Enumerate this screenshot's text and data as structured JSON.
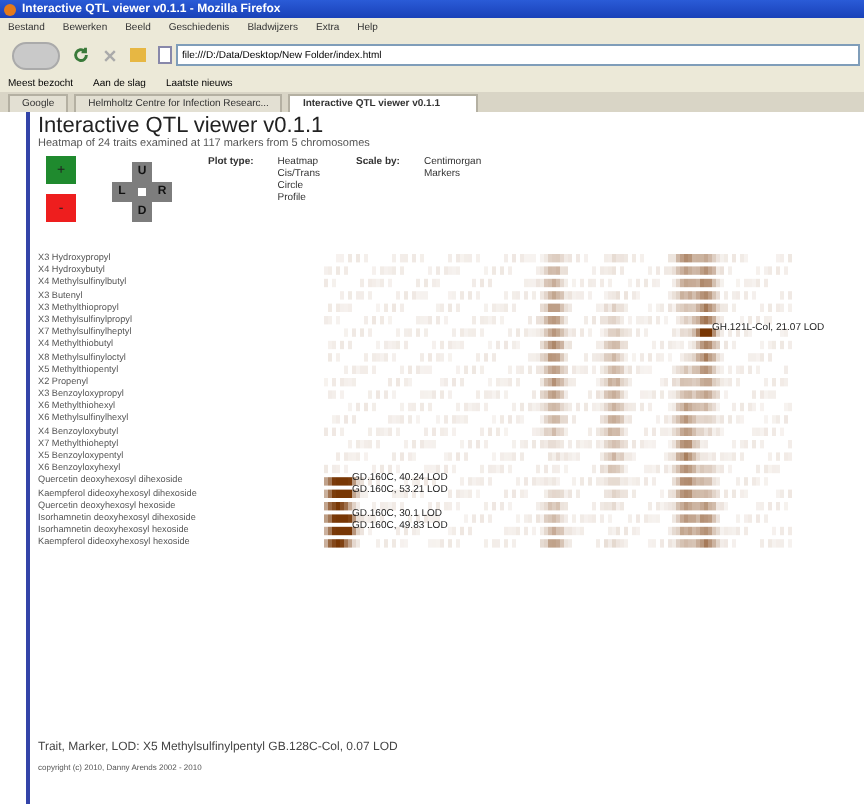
{
  "window": {
    "title": "Interactive QTL viewer v0.1.1 - Mozilla Firefox"
  },
  "menu": [
    "Bestand",
    "Bewerken",
    "Beeld",
    "Geschiedenis",
    "Bladwijzers",
    "Extra",
    "Help"
  ],
  "address": {
    "value": "file:///D:/Data/Desktop/New Folder/index.html"
  },
  "bookmarks": [
    "Meest bezocht",
    "Aan de slag",
    "Laatste nieuws"
  ],
  "tabs": [
    {
      "label": "Google",
      "selected": false
    },
    {
      "label": "Helmholtz Centre for Infection Researc...",
      "selected": false
    },
    {
      "label": "Interactive QTL viewer v0.1.1",
      "selected": true
    }
  ],
  "page": {
    "title": "Interactive QTL viewer v0.1.1",
    "subtitle": "Heatmap of 24 traits examined at 117 markers from 5 chromosomes",
    "zoom_in": "+",
    "zoom_out": "-",
    "pad": [
      "U",
      "L",
      "R",
      "D"
    ],
    "plot_type": {
      "label": "Plot type:",
      "options": [
        "Heatmap",
        "Cis/Trans",
        "Circle",
        "Profile"
      ]
    },
    "scale_by": {
      "label": "Scale by:",
      "options": [
        "Centimorgan",
        "Markers"
      ]
    },
    "traits": [
      "X3 Hydroxypropyl",
      "X4 Hydroxybutyl",
      "X4 Methylsulfinylbutyl",
      "X3 Butenyl",
      "X3 Methylthiopropyl",
      "X3 Methylsulfinylpropyl",
      "X7 Methylsulfinylheptyl",
      "X4 Methylthiobutyl",
      "X8 Methylsulfinyloctyl",
      "X5 Methylthiopentyl",
      "X2 Propenyl",
      "X3 Benzoyloxypropyl",
      "X6 Methylthiohexyl",
      "X6 Methylsulfinylhexyl",
      "X4 Benzoyloxybutyl",
      "X7 Methylthioheptyl",
      "X5 Benzoyloxypentyl",
      "X6 Benzoyloxyhexyl",
      "Quercetin deoxyhexosyl dihexoside",
      "Kaempferol dideoxyhexosyl dihexoside",
      "Quercetin deoxyhexosyl hexoside",
      "Isorhamnetin deoxyhexosyl dihexoside",
      "Isorhamnetin deoxyhexosyl hexoside",
      "Kaempferol dideoxyhexosyl hexoside"
    ],
    "peaks": [
      "GH.121L-Col, 21.07 LOD",
      "GD.160C, 40.24 LOD",
      "GD.160C, 53.21 LOD",
      "GD.160C, 30.1 LOD",
      "GD.160C, 49.83 LOD"
    ],
    "status": "Trait, Marker, LOD: X5 Methylsulfinylpentyl GB.128C-Col, 0.07 LOD",
    "copyright": "copyright (c) 2010, Danny Arends 2002 - 2010"
  }
}
